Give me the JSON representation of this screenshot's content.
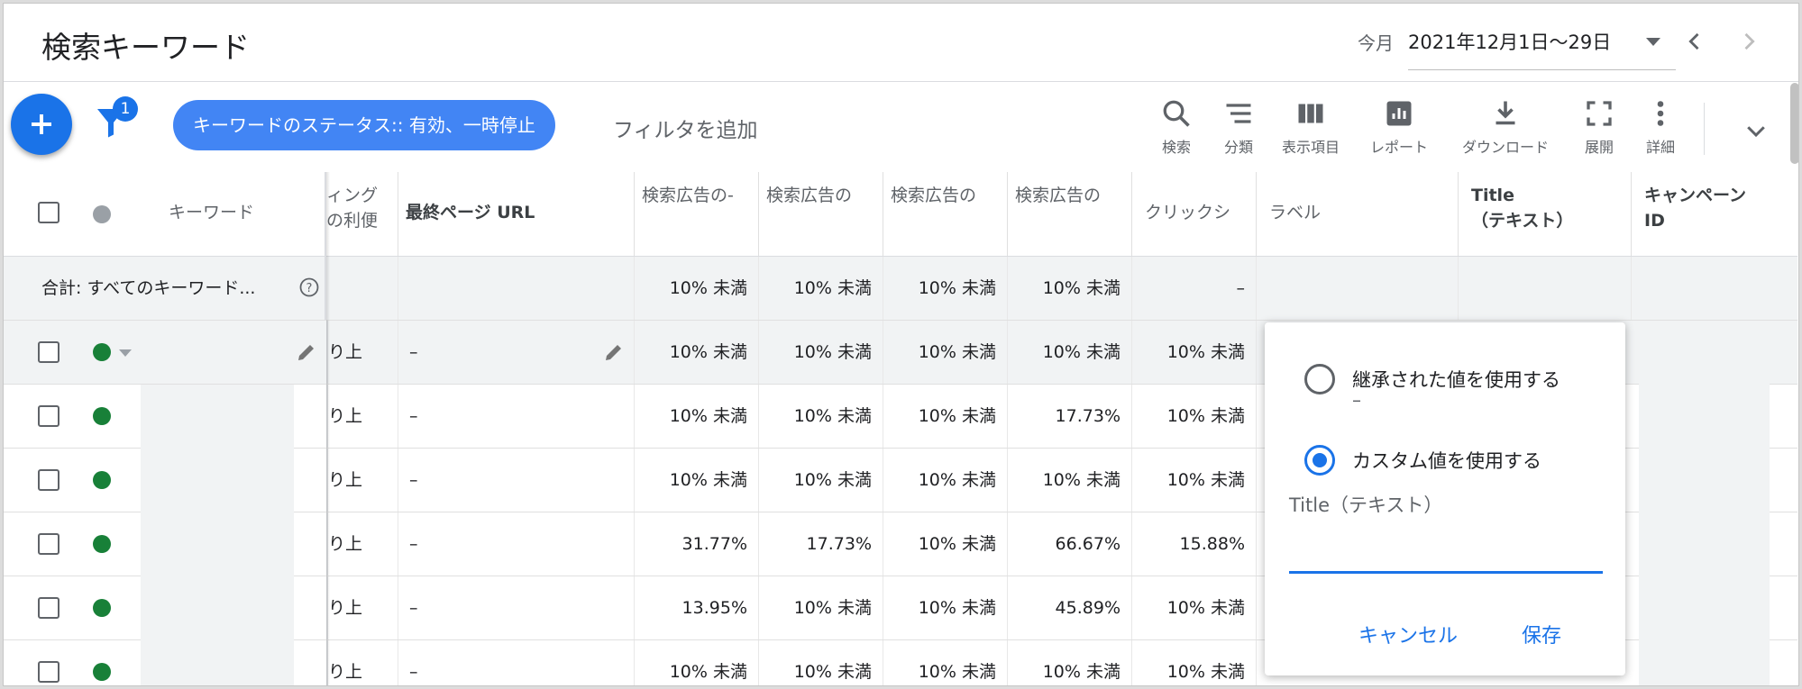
{
  "header": {
    "title": "検索キーワード",
    "date_label": "今月",
    "date_range": "2021年12月1日〜29日"
  },
  "toolbar": {
    "filter_count": "1",
    "filter_chip": "キーワードのステータス:: 有効、一時停止",
    "add_filter": "フィルタを追加",
    "tools": [
      {
        "label": "検索",
        "icon": "search-icon"
      },
      {
        "label": "分類",
        "icon": "segment-icon"
      },
      {
        "label": "表示項目",
        "icon": "columns-icon"
      },
      {
        "label": "レポート",
        "icon": "report-icon"
      },
      {
        "label": "ダウンロード",
        "icon": "download-icon"
      },
      {
        "label": "展開",
        "icon": "fullscreen-icon"
      },
      {
        "label": "詳細",
        "icon": "more-vert-icon"
      }
    ]
  },
  "table": {
    "columns": {
      "keyword": "キーワード",
      "bidding": "ィング\nの利便",
      "final_url": "最終ページ URL",
      "search1": "検索広告の-",
      "search2": "検索広告の",
      "search3": "検索広告の",
      "search4": "検索広告の",
      "click_share": "クリックシ",
      "label": "ラベル",
      "title_text": "Title\n（テキスト）",
      "campaign_id": "キャンペーン\nID"
    },
    "total": {
      "label": "合計: すべてのキーワード...",
      "s1": "10% 未満",
      "s2": "10% 未満",
      "s3": "10% 未満",
      "s4": "10% 未満",
      "click": "–"
    },
    "rows": [
      {
        "bid": "り上",
        "url": "–",
        "s1": "10% 未満",
        "s2": "10% 未満",
        "s3": "10% 未満",
        "s4": "10% 未満",
        "click": "10% 未満"
      },
      {
        "bid": "り上",
        "url": "–",
        "s1": "10% 未満",
        "s2": "10% 未満",
        "s3": "10% 未満",
        "s4": "17.73%",
        "click": "10% 未満"
      },
      {
        "bid": "り上",
        "url": "–",
        "s1": "10% 未満",
        "s2": "10% 未満",
        "s3": "10% 未満",
        "s4": "10% 未満",
        "click": "10% 未満"
      },
      {
        "bid": "り上",
        "url": "–",
        "s1": "31.77%",
        "s2": "17.73%",
        "s3": "10% 未満",
        "s4": "66.67%",
        "click": "15.88%"
      },
      {
        "bid": "り上",
        "url": "–",
        "s1": "13.95%",
        "s2": "10% 未満",
        "s3": "10% 未満",
        "s4": "45.89%",
        "click": "10% 未満"
      },
      {
        "bid": "り上",
        "url": "–",
        "s1": "10% 未満",
        "s2": "10% 未満",
        "s3": "10% 未満",
        "s4": "10% 未満",
        "click": "10% 未満"
      }
    ]
  },
  "popup": {
    "option_inherited": "継承された値を使用する",
    "option_inherited_value": "–",
    "option_custom": "カスタム値を使用する",
    "field_label": "Title（テキスト）",
    "field_value": "",
    "cancel": "キャンセル",
    "save": "保存"
  },
  "colors": {
    "accent": "#1a73e8",
    "chip": "#4285f4",
    "status_enabled": "#188038"
  }
}
